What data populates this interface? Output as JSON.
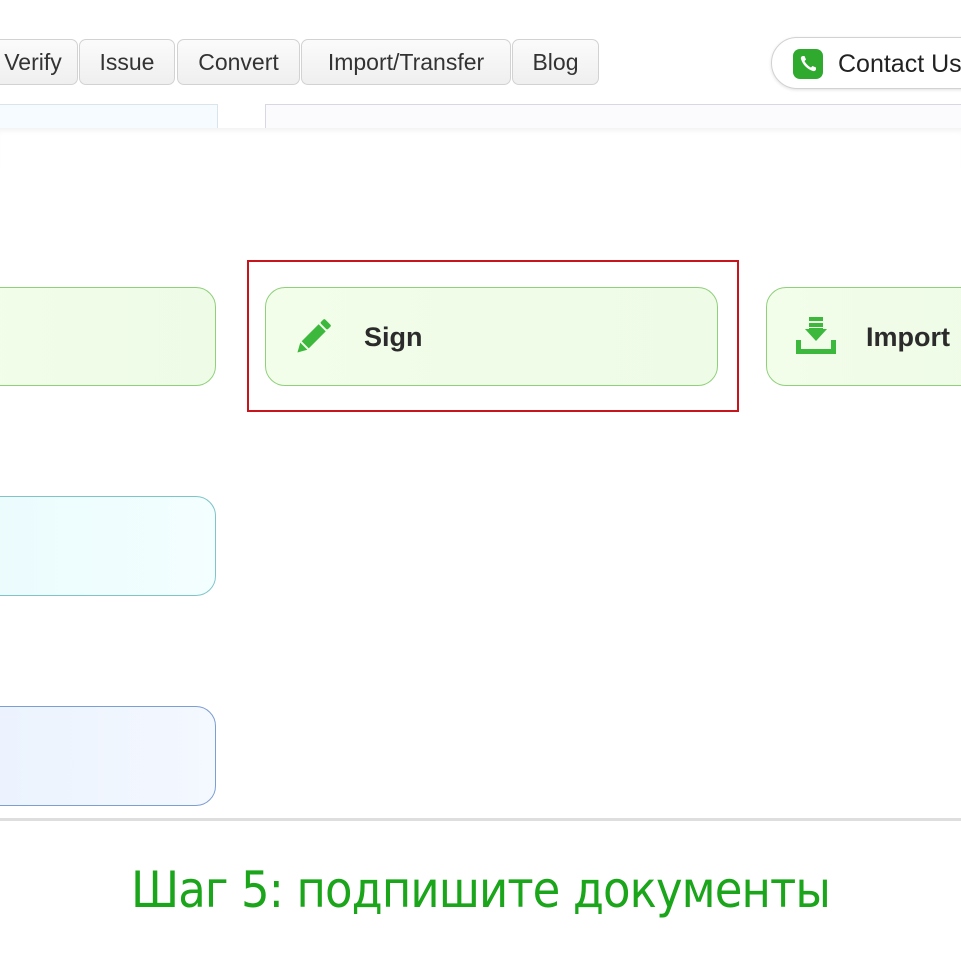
{
  "nav": {
    "tabs": [
      {
        "label": "Verify"
      },
      {
        "label": "Issue"
      },
      {
        "label": "Convert"
      },
      {
        "label": "Import/Transfer"
      },
      {
        "label": "Blog"
      }
    ],
    "contact": {
      "label": "Contact Us",
      "icon": "phone-icon",
      "icon_color": "#2faa2f"
    }
  },
  "actions": {
    "sign": {
      "label": "Sign",
      "icon": "pencil-icon",
      "icon_color": "#3cb83c"
    },
    "import": {
      "label": "Import",
      "icon": "download-icon",
      "icon_color": "#3cb83c"
    },
    "highlight_color": "#c8141b"
  },
  "caption": {
    "text": "Шаг 5: подпишите документы",
    "color": "#1ba51a"
  }
}
